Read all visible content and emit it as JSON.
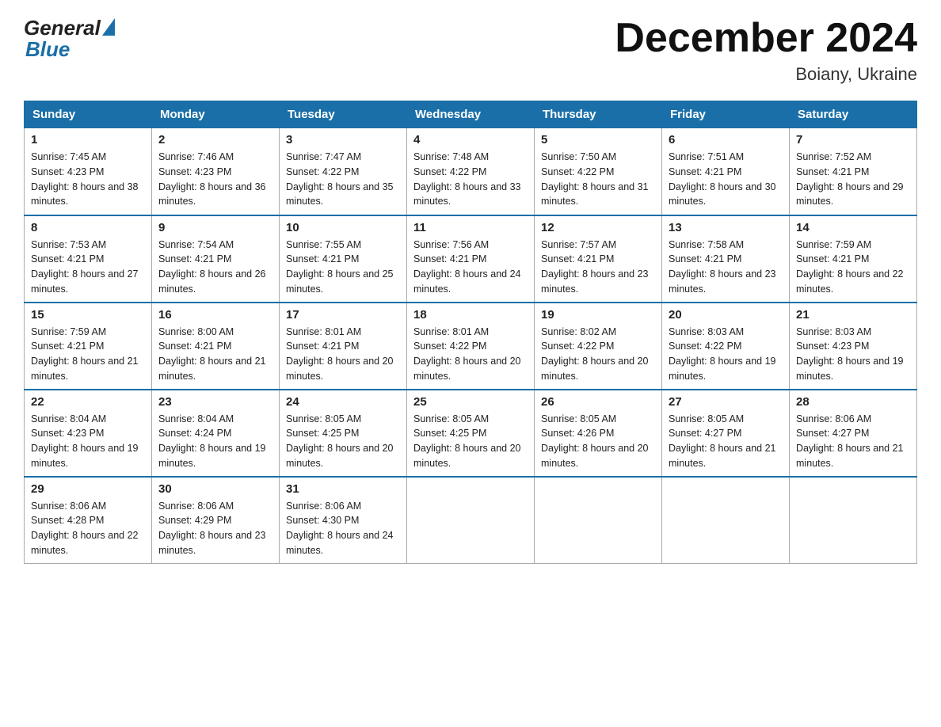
{
  "header": {
    "logo_general": "General",
    "logo_blue": "Blue",
    "month_title": "December 2024",
    "location": "Boiany, Ukraine"
  },
  "weekdays": [
    "Sunday",
    "Monday",
    "Tuesday",
    "Wednesday",
    "Thursday",
    "Friday",
    "Saturday"
  ],
  "weeks": [
    [
      {
        "day": "1",
        "sunrise": "7:45 AM",
        "sunset": "4:23 PM",
        "daylight": "8 hours and 38 minutes."
      },
      {
        "day": "2",
        "sunrise": "7:46 AM",
        "sunset": "4:23 PM",
        "daylight": "8 hours and 36 minutes."
      },
      {
        "day": "3",
        "sunrise": "7:47 AM",
        "sunset": "4:22 PM",
        "daylight": "8 hours and 35 minutes."
      },
      {
        "day": "4",
        "sunrise": "7:48 AM",
        "sunset": "4:22 PM",
        "daylight": "8 hours and 33 minutes."
      },
      {
        "day": "5",
        "sunrise": "7:50 AM",
        "sunset": "4:22 PM",
        "daylight": "8 hours and 31 minutes."
      },
      {
        "day": "6",
        "sunrise": "7:51 AM",
        "sunset": "4:21 PM",
        "daylight": "8 hours and 30 minutes."
      },
      {
        "day": "7",
        "sunrise": "7:52 AM",
        "sunset": "4:21 PM",
        "daylight": "8 hours and 29 minutes."
      }
    ],
    [
      {
        "day": "8",
        "sunrise": "7:53 AM",
        "sunset": "4:21 PM",
        "daylight": "8 hours and 27 minutes."
      },
      {
        "day": "9",
        "sunrise": "7:54 AM",
        "sunset": "4:21 PM",
        "daylight": "8 hours and 26 minutes."
      },
      {
        "day": "10",
        "sunrise": "7:55 AM",
        "sunset": "4:21 PM",
        "daylight": "8 hours and 25 minutes."
      },
      {
        "day": "11",
        "sunrise": "7:56 AM",
        "sunset": "4:21 PM",
        "daylight": "8 hours and 24 minutes."
      },
      {
        "day": "12",
        "sunrise": "7:57 AM",
        "sunset": "4:21 PM",
        "daylight": "8 hours and 23 minutes."
      },
      {
        "day": "13",
        "sunrise": "7:58 AM",
        "sunset": "4:21 PM",
        "daylight": "8 hours and 23 minutes."
      },
      {
        "day": "14",
        "sunrise": "7:59 AM",
        "sunset": "4:21 PM",
        "daylight": "8 hours and 22 minutes."
      }
    ],
    [
      {
        "day": "15",
        "sunrise": "7:59 AM",
        "sunset": "4:21 PM",
        "daylight": "8 hours and 21 minutes."
      },
      {
        "day": "16",
        "sunrise": "8:00 AM",
        "sunset": "4:21 PM",
        "daylight": "8 hours and 21 minutes."
      },
      {
        "day": "17",
        "sunrise": "8:01 AM",
        "sunset": "4:21 PM",
        "daylight": "8 hours and 20 minutes."
      },
      {
        "day": "18",
        "sunrise": "8:01 AM",
        "sunset": "4:22 PM",
        "daylight": "8 hours and 20 minutes."
      },
      {
        "day": "19",
        "sunrise": "8:02 AM",
        "sunset": "4:22 PM",
        "daylight": "8 hours and 20 minutes."
      },
      {
        "day": "20",
        "sunrise": "8:03 AM",
        "sunset": "4:22 PM",
        "daylight": "8 hours and 19 minutes."
      },
      {
        "day": "21",
        "sunrise": "8:03 AM",
        "sunset": "4:23 PM",
        "daylight": "8 hours and 19 minutes."
      }
    ],
    [
      {
        "day": "22",
        "sunrise": "8:04 AM",
        "sunset": "4:23 PM",
        "daylight": "8 hours and 19 minutes."
      },
      {
        "day": "23",
        "sunrise": "8:04 AM",
        "sunset": "4:24 PM",
        "daylight": "8 hours and 19 minutes."
      },
      {
        "day": "24",
        "sunrise": "8:05 AM",
        "sunset": "4:25 PM",
        "daylight": "8 hours and 20 minutes."
      },
      {
        "day": "25",
        "sunrise": "8:05 AM",
        "sunset": "4:25 PM",
        "daylight": "8 hours and 20 minutes."
      },
      {
        "day": "26",
        "sunrise": "8:05 AM",
        "sunset": "4:26 PM",
        "daylight": "8 hours and 20 minutes."
      },
      {
        "day": "27",
        "sunrise": "8:05 AM",
        "sunset": "4:27 PM",
        "daylight": "8 hours and 21 minutes."
      },
      {
        "day": "28",
        "sunrise": "8:06 AM",
        "sunset": "4:27 PM",
        "daylight": "8 hours and 21 minutes."
      }
    ],
    [
      {
        "day": "29",
        "sunrise": "8:06 AM",
        "sunset": "4:28 PM",
        "daylight": "8 hours and 22 minutes."
      },
      {
        "day": "30",
        "sunrise": "8:06 AM",
        "sunset": "4:29 PM",
        "daylight": "8 hours and 23 minutes."
      },
      {
        "day": "31",
        "sunrise": "8:06 AM",
        "sunset": "4:30 PM",
        "daylight": "8 hours and 24 minutes."
      },
      null,
      null,
      null,
      null
    ]
  ]
}
